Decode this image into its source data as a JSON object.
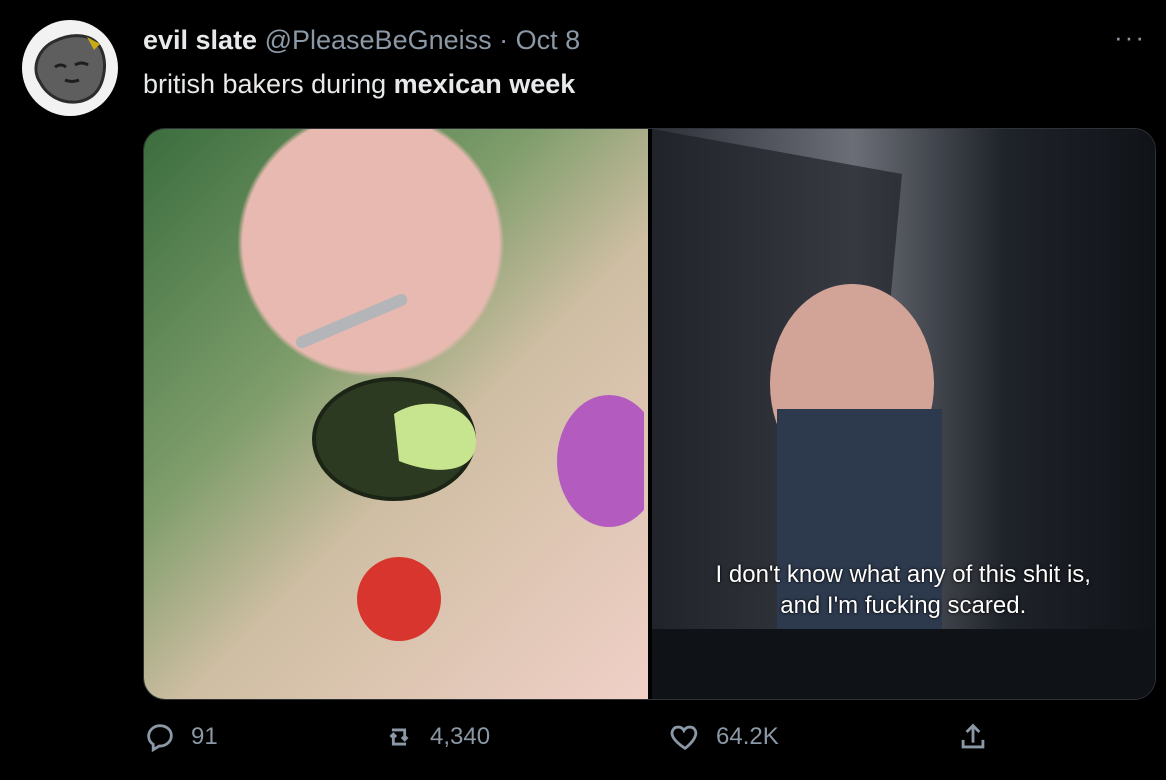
{
  "tweet": {
    "display_name": "evil slate",
    "handle": "@PleaseBeGneiss",
    "separator": "·",
    "date": "Oct 8",
    "text_plain": "british bakers during ",
    "text_bold": "mexican week",
    "more": "···"
  },
  "media": {
    "right_caption_line1": "I don't know what any of this shit is,",
    "right_caption_line2": "and I'm fucking scared."
  },
  "actions": {
    "reply_count": "91",
    "retweet_count": "4,340",
    "like_count": "64.2K"
  },
  "icons": {
    "reply": "reply-icon",
    "retweet": "retweet-icon",
    "like": "heart-icon",
    "share": "share-icon",
    "more": "more-icon"
  }
}
